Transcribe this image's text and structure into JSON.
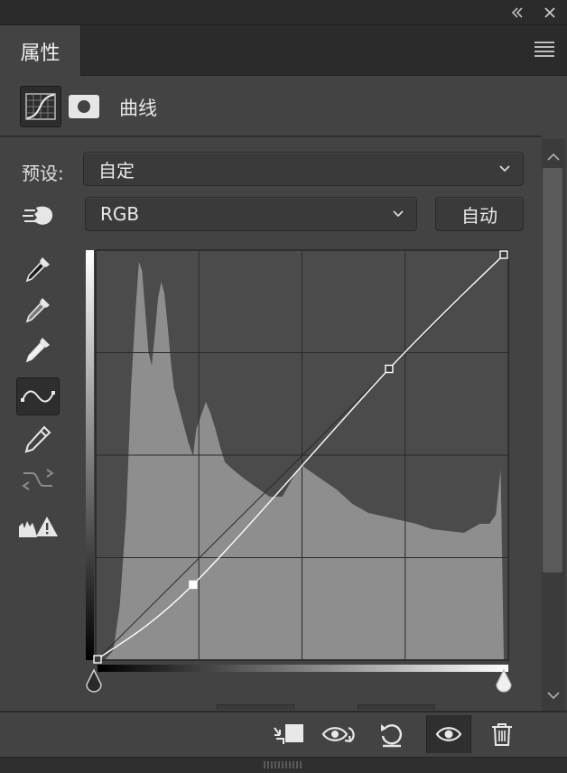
{
  "window": {
    "collapse_icon": "double-chevron-left-icon",
    "close_icon": "close-icon"
  },
  "tab": {
    "title": "属性",
    "menu_icon": "hamburger-menu-icon"
  },
  "header": {
    "title": "曲线",
    "icons": [
      "curves-adjustment-icon",
      "layer-mask-icon"
    ]
  },
  "preset": {
    "label": "预设:",
    "value": "自定"
  },
  "channel": {
    "value": "RGB"
  },
  "auto_button": {
    "label": "自动"
  },
  "tools": [
    "target-adjust-hand-icon",
    "black-point-eyedropper-icon",
    "gray-point-eyedropper-icon",
    "white-point-eyedropper-icon",
    "curve-edit-points-icon",
    "pencil-draw-icon",
    "smooth-curve-icon",
    "clipping-warning-icon"
  ],
  "curve": {
    "points": [
      [
        0,
        0
      ],
      [
        60,
        47
      ],
      [
        183,
        183
      ],
      [
        255,
        255
      ]
    ],
    "active_point": [
      60,
      47
    ],
    "grid_divisions": 4
  },
  "bottom_bar": {
    "icons": [
      "clip-to-layer-icon",
      "view-previous-state-icon",
      "reset-icon",
      "visibility-eye-icon",
      "trash-icon"
    ]
  },
  "colors": {
    "panel": "#434343",
    "dark": "#2b2b2b",
    "histogram": "#8e8e8e",
    "curve": "#ffffff"
  }
}
